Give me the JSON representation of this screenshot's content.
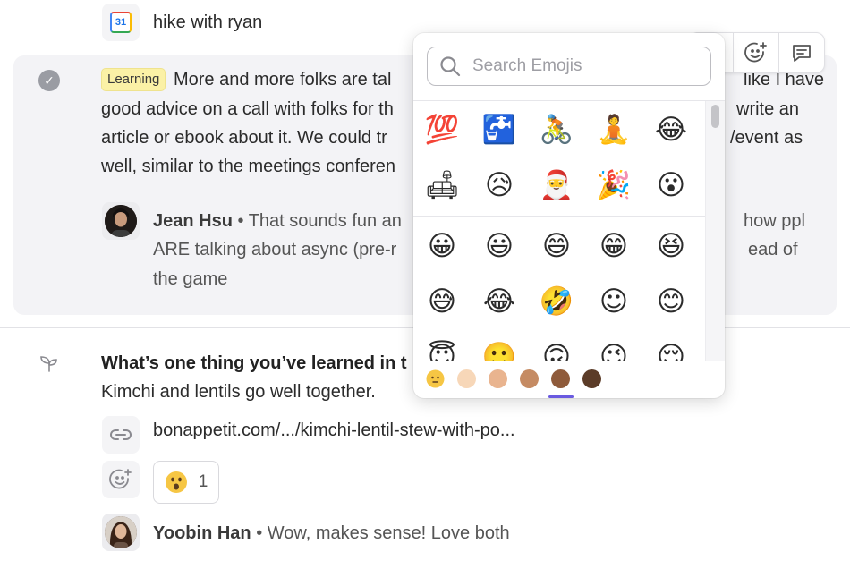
{
  "top_item": {
    "title": "hike with ryan",
    "icon": "calendar-icon",
    "calendar_day": "31"
  },
  "learning_card": {
    "tag": "Learning",
    "lines": [
      "More and more folks are tal",
      "good advice on a call with folks for th",
      "article or ebook about it. We could tr",
      "well, similar to the meetings conferen"
    ],
    "right_fragments": [
      "like I have",
      "write an",
      "/event as"
    ],
    "comment": {
      "author": "Jean Hsu",
      "line1": "• That sounds fun an",
      "line1_right": "how ppl",
      "line2": "ARE talking about async (pre-r",
      "line2_right": "ead of",
      "line3": "the game"
    }
  },
  "question": {
    "title": "What’s one thing you’ve learned in t",
    "answer": "Kimchi and lentils go well together.",
    "link": "bonappetit.com/.../kimchi-lentil-stew-with-po...",
    "reaction_count": "1",
    "reply": {
      "author": "Yoobin Han",
      "text": "• Wow, makes sense! Love both"
    }
  },
  "toolbar": {
    "buttons": [
      "add-reaction-icon",
      "comment-icon"
    ]
  },
  "emoji_picker": {
    "search_placeholder": "Search Emojis",
    "recent_rows": [
      [
        "💯",
        "🚰",
        "🚴",
        "🧘",
        "😂"
      ],
      [
        "🛋",
        "😥",
        "🎅",
        "🎉",
        "😮"
      ]
    ],
    "smiley_rows": [
      [
        "😀",
        "😃",
        "😄",
        "😁",
        "😆"
      ],
      [
        "😅",
        "😂",
        "🤣",
        "☺",
        "😊"
      ],
      [
        "😇",
        "🙂",
        "🙃",
        "😉",
        "😌"
      ]
    ],
    "skin_tones": [
      "#f6c644",
      "#f7d7b8",
      "#e9b48f",
      "#c58b63",
      "#8f5b3b",
      "#5b3c28"
    ],
    "selected_tone_index": 4
  },
  "colors": {
    "accent": "#6a5ae0",
    "card_bg": "#f3f3f6",
    "tag_bg": "#fbf1a6"
  }
}
